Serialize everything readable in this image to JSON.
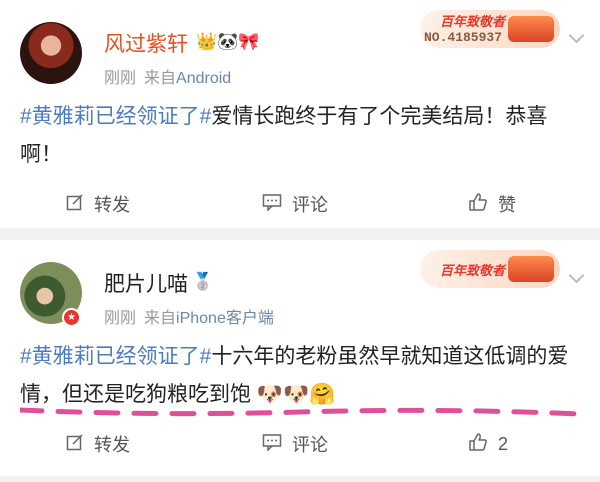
{
  "posts": [
    {
      "username": "风过紫轩",
      "name_icons": "👑🐼🎀",
      "time": "刚刚",
      "source_prefix": "来自",
      "source_device": "Android",
      "badge_title": "百年致敬者",
      "badge_number": "NO.4185937",
      "text_tag": "#黄雅莉已经领证了#",
      "text_body": "爱情长跑终于有了个完美结局！恭喜啊！",
      "actions": {
        "repost": "转发",
        "comment": "评论",
        "like": "赞"
      }
    },
    {
      "username": "肥片儿喵",
      "name_icons": "🥈",
      "time": "刚刚",
      "source_prefix": "来自",
      "source_device": "iPhone客户端",
      "badge_title": "百年致敬者",
      "text_tag": "#黄雅莉已经领证了#",
      "text_body": "十六年的老粉虽然早就知道这低调的爱情，但还是吃狗粮吃到饱",
      "emojis": "🐶🐶🤗",
      "actions": {
        "repost": "转发",
        "comment": "评论",
        "like": "2"
      }
    }
  ],
  "icons": {
    "repost": "edit-square-icon",
    "comment": "comment-icon",
    "like": "thumbs-up-icon",
    "more": "chevron-down-icon",
    "verified": "star-badge-icon"
  },
  "colors": {
    "username_vip": "#e8501e",
    "topic_link": "#4a7cbf",
    "meta": "#999999",
    "dash_annotation": "#e0509a"
  }
}
